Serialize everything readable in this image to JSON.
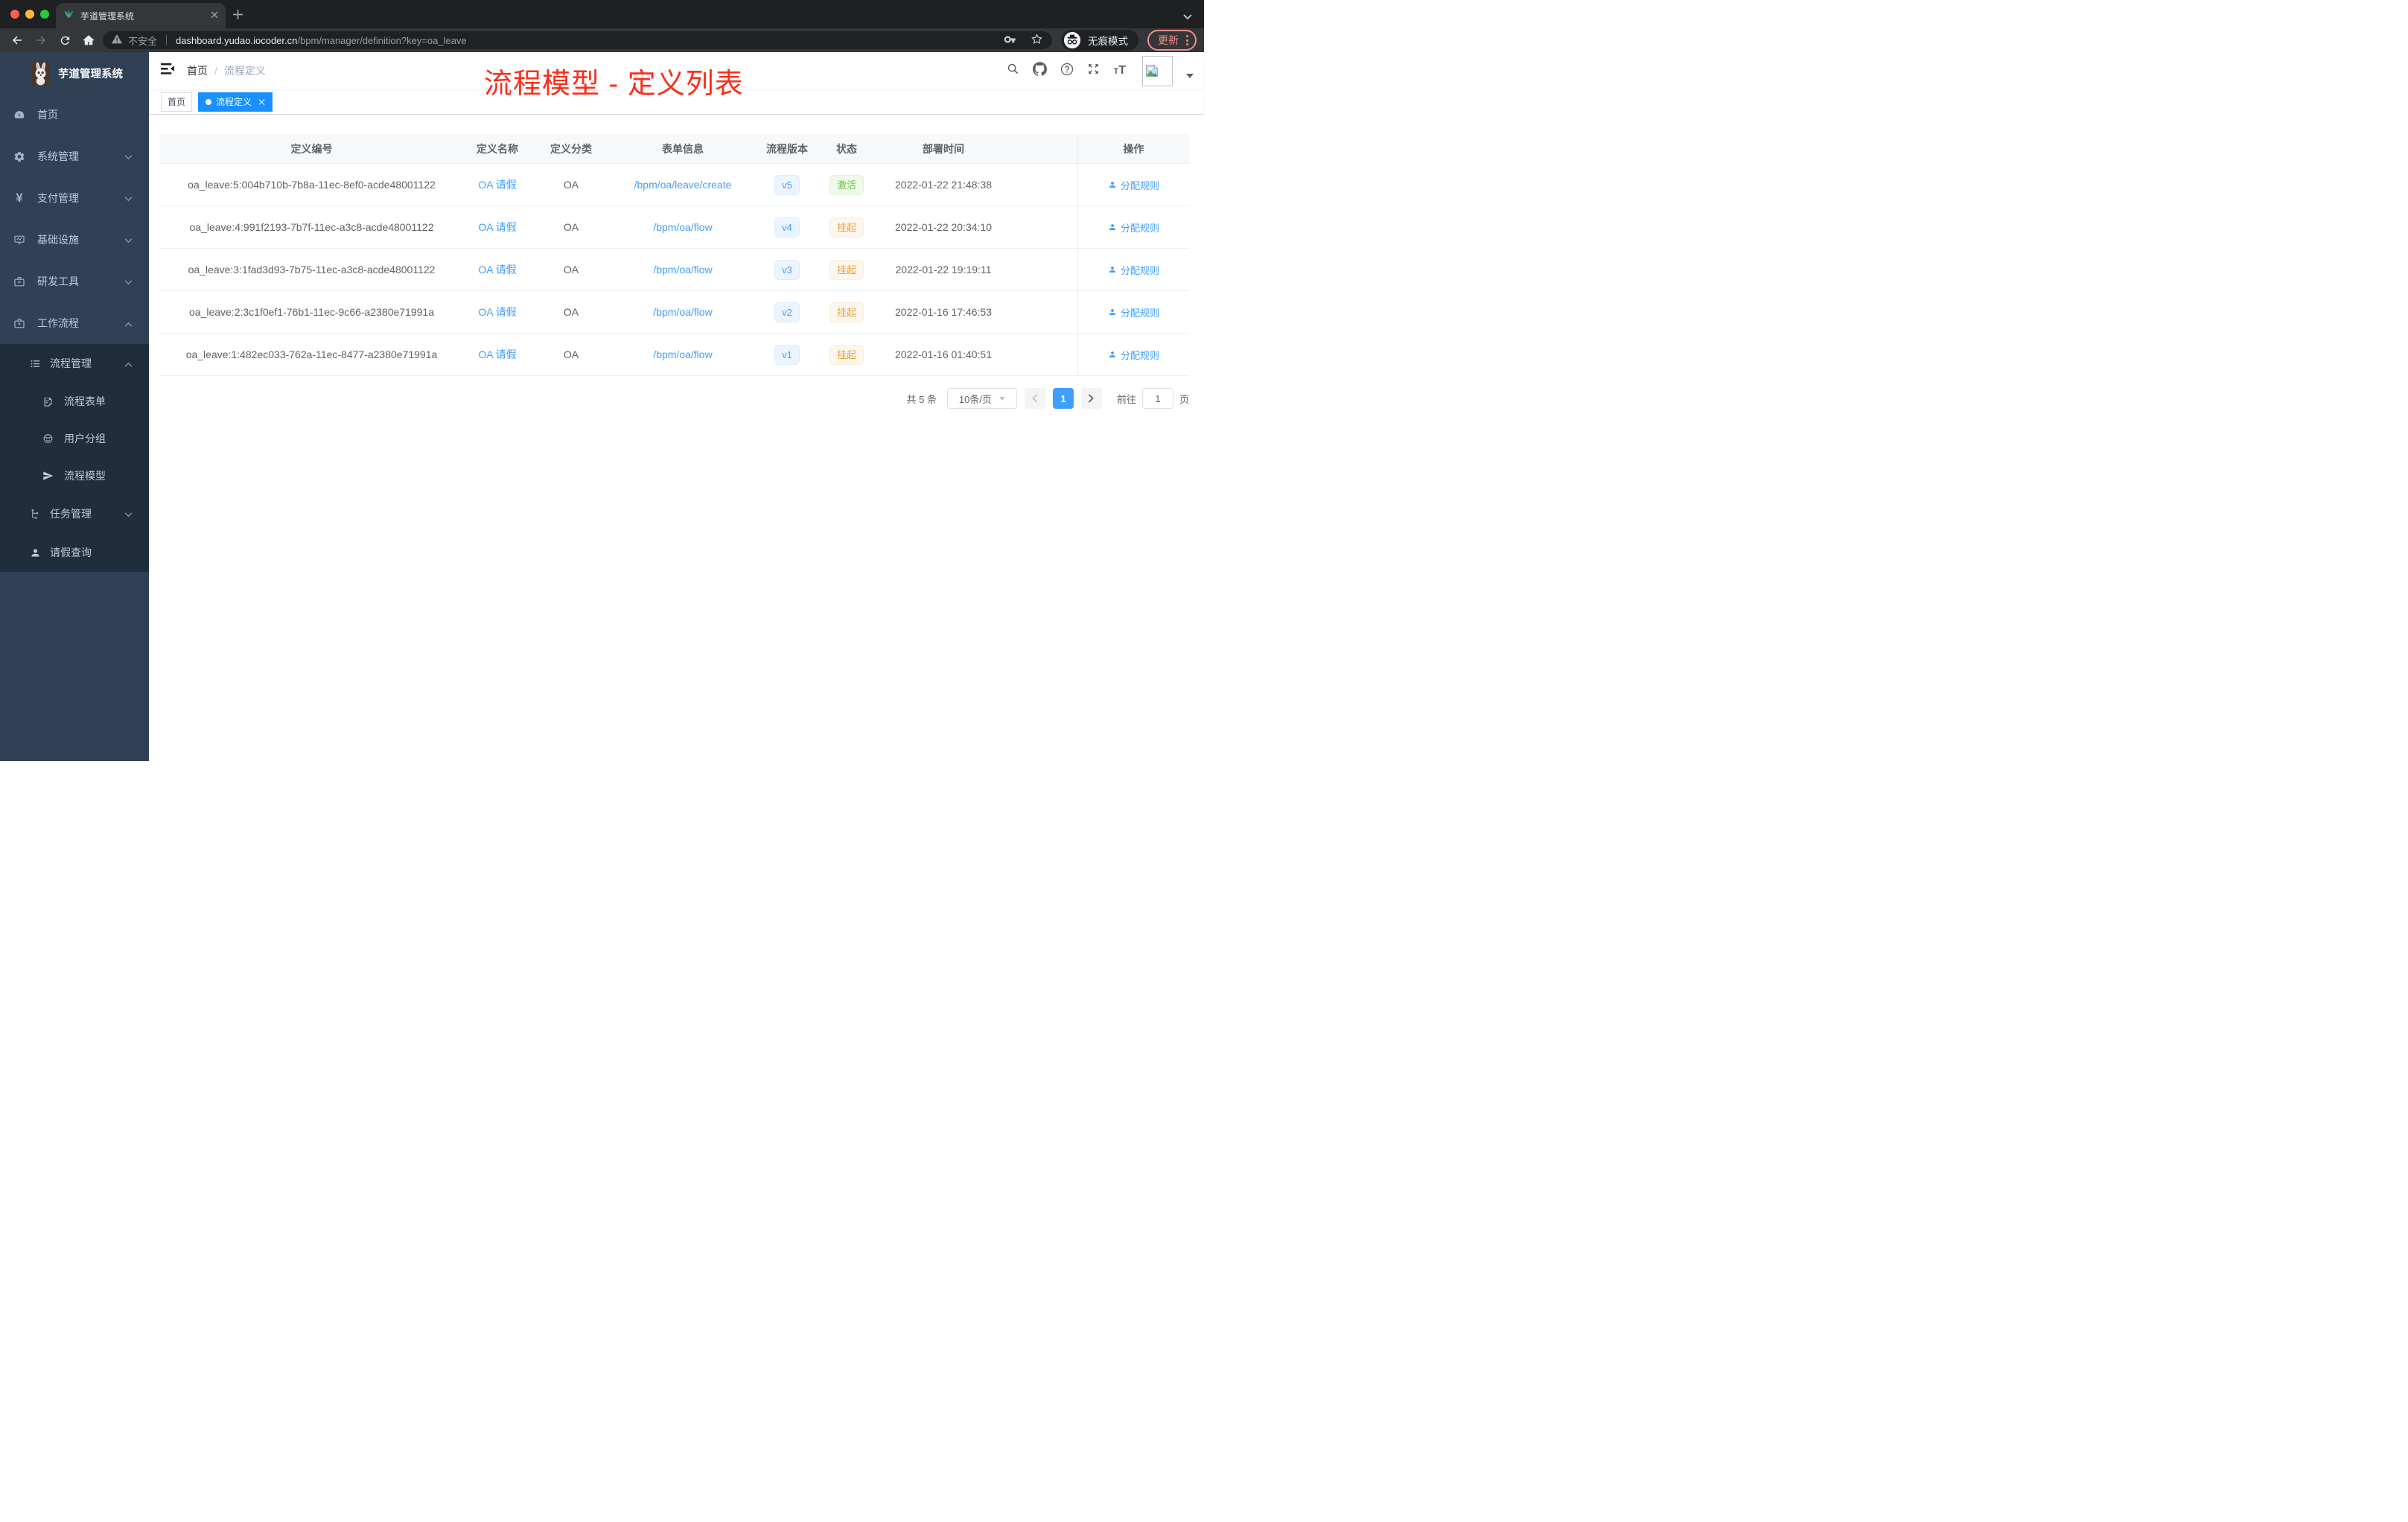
{
  "browser": {
    "tab_title": "芋道管理系统",
    "security_label": "不安全",
    "url_host": "dashboard.yudao.iocoder.cn",
    "url_path": "/bpm/manager/definition?key=oa_leave",
    "incognito_label": "无痕模式",
    "update_label": "更新"
  },
  "sidebar": {
    "logo_title": "芋道管理系统",
    "items": [
      {
        "label": "首页"
      },
      {
        "label": "系统管理"
      },
      {
        "label": "支付管理"
      },
      {
        "label": "基础设施"
      },
      {
        "label": "研发工具"
      },
      {
        "label": "工作流程"
      }
    ],
    "submenu": [
      {
        "label": "流程管理"
      },
      {
        "label": "流程表单"
      },
      {
        "label": "用户分组"
      },
      {
        "label": "流程模型"
      },
      {
        "label": "任务管理"
      },
      {
        "label": "请假查询"
      }
    ]
  },
  "header": {
    "breadcrumb_home": "首页",
    "breadcrumb_sep": "/",
    "breadcrumb_current": "流程定义",
    "annotation": "流程模型 - 定义列表"
  },
  "tags": {
    "home": "首页",
    "active": "流程定义"
  },
  "table": {
    "columns": [
      "定义编号",
      "定义名称",
      "定义分类",
      "表单信息",
      "流程版本",
      "状态",
      "部署时间",
      "操作"
    ],
    "rows": [
      {
        "id": "oa_leave:5:004b710b-7b8a-11ec-8ef0-acde48001122",
        "name": "OA 请假",
        "category": "OA",
        "form": "/bpm/oa/leave/create",
        "version": "v5",
        "status": "激活",
        "status_class": "active",
        "time": "2022-01-22 21:48:38",
        "action": "分配规则"
      },
      {
        "id": "oa_leave:4:991f2193-7b7f-11ec-a3c8-acde48001122",
        "name": "OA 请假",
        "category": "OA",
        "form": "/bpm/oa/flow",
        "version": "v4",
        "status": "挂起",
        "status_class": "suspended",
        "time": "2022-01-22 20:34:10",
        "action": "分配规则"
      },
      {
        "id": "oa_leave:3:1fad3d93-7b75-11ec-a3c8-acde48001122",
        "name": "OA 请假",
        "category": "OA",
        "form": "/bpm/oa/flow",
        "version": "v3",
        "status": "挂起",
        "status_class": "suspended",
        "time": "2022-01-22 19:19:11",
        "action": "分配规则"
      },
      {
        "id": "oa_leave:2:3c1f0ef1-76b1-11ec-9c66-a2380e71991a",
        "name": "OA 请假",
        "category": "OA",
        "form": "/bpm/oa/flow",
        "version": "v2",
        "status": "挂起",
        "status_class": "suspended",
        "time": "2022-01-16 17:46:53",
        "action": "分配规则"
      },
      {
        "id": "oa_leave:1:482ec033-762a-11ec-8477-a2380e71991a",
        "name": "OA 请假",
        "category": "OA",
        "form": "/bpm/oa/flow",
        "version": "v1",
        "status": "挂起",
        "status_class": "suspended",
        "time": "2022-01-16 01:40:51",
        "action": "分配规则"
      }
    ]
  },
  "pagination": {
    "total": "共 5 条",
    "page_size": "10条/页",
    "current_page": "1",
    "goto_label": "前往",
    "goto_value": "1",
    "page_suffix": "页"
  },
  "colors": {
    "accent": "#409eff",
    "active_tag": "#1890ff",
    "status_active": "#67c23a",
    "status_suspended": "#e6a23c",
    "annotation": "#fe2c19",
    "sidebar_bg": "#304156",
    "submenu_bg": "#1f2d3d"
  }
}
